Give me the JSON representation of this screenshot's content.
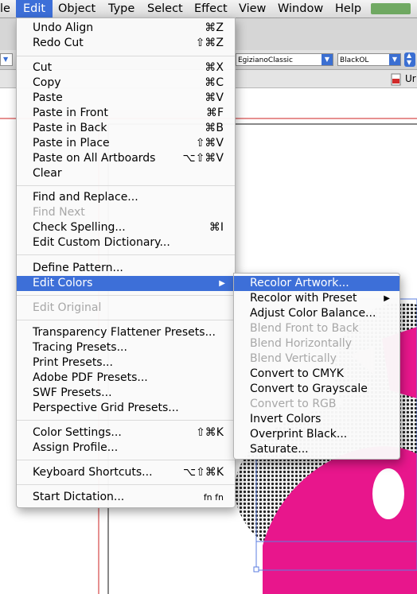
{
  "menubar": {
    "items": [
      {
        "label": "le",
        "active": false
      },
      {
        "label": "Edit",
        "active": true
      },
      {
        "label": "Object",
        "active": false
      },
      {
        "label": "Type",
        "active": false
      },
      {
        "label": "Select",
        "active": false
      },
      {
        "label": "Effect",
        "active": false
      },
      {
        "label": "View",
        "active": false
      },
      {
        "label": "Window",
        "active": false
      },
      {
        "label": "Help",
        "active": false
      }
    ]
  },
  "control_bar": {
    "font_family": "EgizianoClassic",
    "font_style": "BlackOL"
  },
  "doc_tab": {
    "label": "Ur"
  },
  "edit_menu": {
    "items": [
      {
        "label": "Undo Align",
        "shortcut": "⌘Z"
      },
      {
        "label": "Redo Cut",
        "shortcut": "⇧⌘Z"
      },
      {
        "label": "Cut",
        "shortcut": "⌘X"
      },
      {
        "label": "Copy",
        "shortcut": "⌘C"
      },
      {
        "label": "Paste",
        "shortcut": "⌘V"
      },
      {
        "label": "Paste in Front",
        "shortcut": "⌘F"
      },
      {
        "label": "Paste in Back",
        "shortcut": "⌘B"
      },
      {
        "label": "Paste in Place",
        "shortcut": "⇧⌘V"
      },
      {
        "label": "Paste on All Artboards",
        "shortcut": "⌥⇧⌘V"
      },
      {
        "label": "Clear",
        "shortcut": ""
      },
      {
        "label": "Find and Replace...",
        "shortcut": ""
      },
      {
        "label": "Find Next",
        "shortcut": ""
      },
      {
        "label": "Check Spelling...",
        "shortcut": "⌘I"
      },
      {
        "label": "Edit Custom Dictionary...",
        "shortcut": ""
      },
      {
        "label": "Define Pattern...",
        "shortcut": ""
      },
      {
        "label": "Edit Colors",
        "shortcut": ""
      },
      {
        "label": "Edit Original",
        "shortcut": ""
      },
      {
        "label": "Transparency Flattener Presets...",
        "shortcut": ""
      },
      {
        "label": "Tracing Presets...",
        "shortcut": ""
      },
      {
        "label": "Print Presets...",
        "shortcut": ""
      },
      {
        "label": "Adobe PDF Presets...",
        "shortcut": ""
      },
      {
        "label": "SWF Presets...",
        "shortcut": ""
      },
      {
        "label": "Perspective Grid Presets...",
        "shortcut": ""
      },
      {
        "label": "Color Settings...",
        "shortcut": "⇧⌘K"
      },
      {
        "label": "Assign Profile...",
        "shortcut": ""
      },
      {
        "label": "Keyboard Shortcuts...",
        "shortcut": "⌥⇧⌘K"
      },
      {
        "label": "Start Dictation...",
        "shortcut": "fn fn"
      }
    ]
  },
  "colors_submenu": {
    "items": [
      {
        "label": "Recolor Artwork..."
      },
      {
        "label": "Recolor with Preset"
      },
      {
        "label": "Adjust Color Balance..."
      },
      {
        "label": "Blend Front to Back"
      },
      {
        "label": "Blend Horizontally"
      },
      {
        "label": "Blend Vertically"
      },
      {
        "label": "Convert to CMYK"
      },
      {
        "label": "Convert to Grayscale"
      },
      {
        "label": "Convert to RGB"
      },
      {
        "label": "Invert Colors"
      },
      {
        "label": "Overprint Black..."
      },
      {
        "label": "Saturate..."
      }
    ]
  },
  "colors": {
    "highlight": "#3d6fd8",
    "artwork_pink": "#e8168c"
  }
}
